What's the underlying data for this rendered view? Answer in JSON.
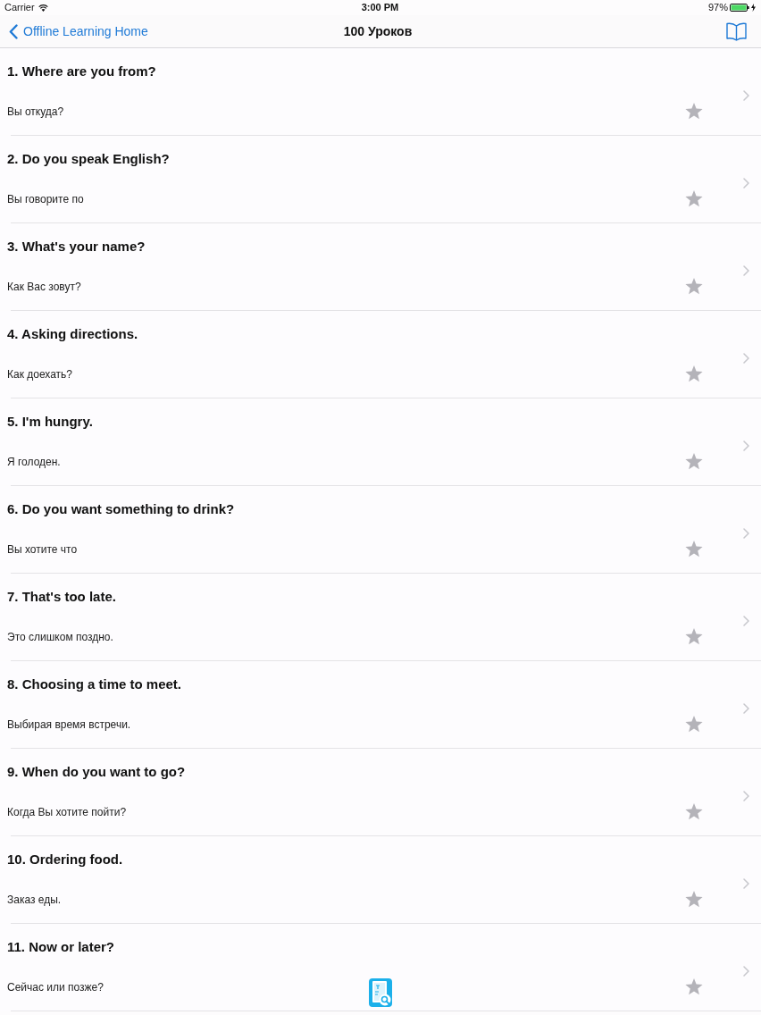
{
  "status_bar": {
    "carrier": "Carrier",
    "time": "3:00 PM",
    "battery": "97%",
    "charging": true
  },
  "nav_bar": {
    "back": "Offline Learning Home",
    "title": "100 Уроков"
  },
  "lessons": [
    {
      "title": "1. Where are you from?",
      "translation": "Вы откуда?",
      "favorite": false
    },
    {
      "title": "2. Do you speak English?",
      "translation": "Вы говорите по",
      "favorite": false
    },
    {
      "title": "3. What's your name?",
      "translation": "Как Вас зовут?",
      "favorite": false
    },
    {
      "title": "4. Asking directions.",
      "translation": "Как доехать?",
      "favorite": false
    },
    {
      "title": "5. I'm hungry.",
      "translation": "Я голоден.",
      "favorite": false
    },
    {
      "title": "6. Do you want something to drink?",
      "translation": "Вы хотите что",
      "favorite": false
    },
    {
      "title": "7. That's too late.",
      "translation": "Это слишком поздно.",
      "favorite": false
    },
    {
      "title": "8. Choosing a time to meet.",
      "translation": "Выбирая время встречи.",
      "favorite": false
    },
    {
      "title": "9. When do you want to go?",
      "translation": "Когда Вы хотите пойти?",
      "favorite": false
    },
    {
      "title": "10. Ordering food.",
      "translation": "Заказ еды.",
      "favorite": false
    },
    {
      "title": "11. Now or later?",
      "translation": "Сейчас или позже?",
      "favorite": false
    }
  ]
}
